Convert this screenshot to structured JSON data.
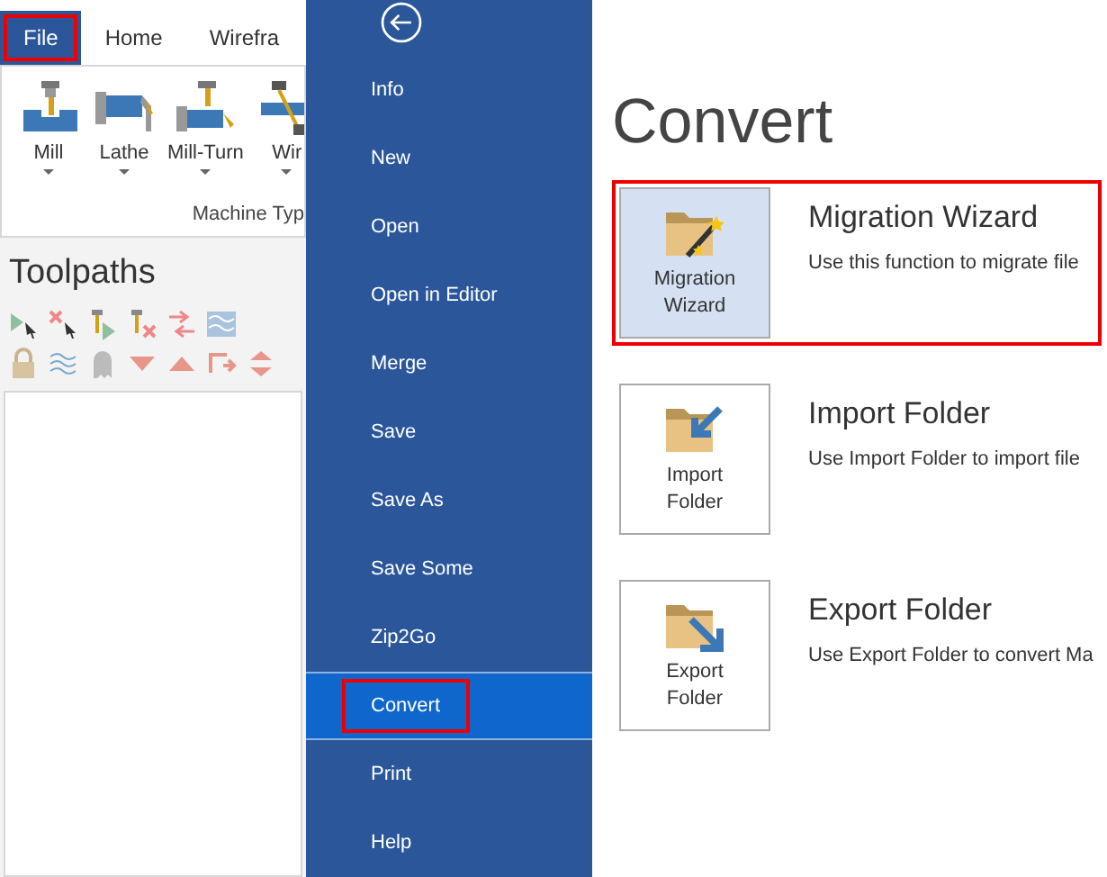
{
  "ribbon": {
    "tabs": [
      {
        "label": "File",
        "selected": true,
        "highlighted": true
      },
      {
        "label": "Home",
        "selected": false,
        "highlighted": false
      },
      {
        "label": "Wirefra",
        "selected": false,
        "highlighted": false
      }
    ],
    "buttons": [
      {
        "label": "Mill",
        "kind": "mill"
      },
      {
        "label": "Lathe",
        "kind": "lathe"
      },
      {
        "label": "Mill-Turn",
        "kind": "millturn"
      },
      {
        "label": "Wir",
        "kind": "wire"
      }
    ],
    "group_label": "Machine Typ"
  },
  "panel": {
    "title": "Toolpaths"
  },
  "menu": {
    "items": [
      {
        "label": "Info",
        "selected": false,
        "highlighted": false
      },
      {
        "label": "New",
        "selected": false,
        "highlighted": false
      },
      {
        "label": "Open",
        "selected": false,
        "highlighted": false
      },
      {
        "label": "Open in Editor",
        "selected": false,
        "highlighted": false
      },
      {
        "label": "Merge",
        "selected": false,
        "highlighted": false
      },
      {
        "label": "Save",
        "selected": false,
        "highlighted": false
      },
      {
        "label": "Save As",
        "selected": false,
        "highlighted": false
      },
      {
        "label": "Save Some",
        "selected": false,
        "highlighted": false
      },
      {
        "label": "Zip2Go",
        "selected": false,
        "highlighted": false
      },
      {
        "label": "Convert",
        "selected": true,
        "highlighted": true
      },
      {
        "label": "Print",
        "selected": false,
        "highlighted": false
      },
      {
        "label": "Help",
        "selected": false,
        "highlighted": false
      }
    ]
  },
  "content": {
    "title": "Convert",
    "options": [
      {
        "kind": "wizard",
        "button_label": "Migration Wizard",
        "title": "Migration Wizard",
        "description": "Use this function to migrate file",
        "selected": true,
        "highlighted": true
      },
      {
        "kind": "import",
        "button_label": "Import Folder",
        "title": "Import Folder",
        "description": "Use Import Folder to import file",
        "selected": false,
        "highlighted": false
      },
      {
        "kind": "export",
        "button_label": "Export Folder",
        "title": "Export Folder",
        "description": "Use Export Folder to convert Ma",
        "selected": false,
        "highlighted": false
      }
    ]
  }
}
